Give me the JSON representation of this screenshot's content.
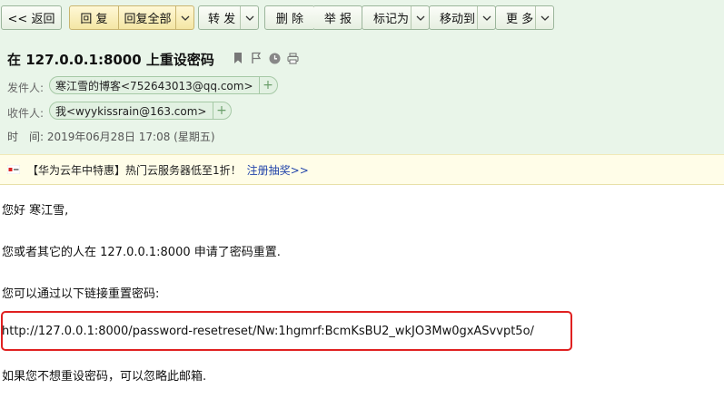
{
  "toolbar": {
    "back": "<< 返回",
    "reply": "回 复",
    "reply_all": "回复全部",
    "forward": "转 发",
    "delete": "删 除",
    "report": "举 报",
    "mark_as": "标记为",
    "move_to": "移动到",
    "more": "更 多"
  },
  "mail": {
    "subject": "在 127.0.0.1:8000 上重设密码",
    "from_label": "发件人:",
    "from_value": "寒江雪的博客<752643013@qq.com>",
    "to_label": "收件人:",
    "to_value": "我<wyykissrain@163.com>",
    "time_label": "时　间:",
    "time_value": "2019年06月28日 17:08 (星期五)"
  },
  "banner": {
    "text": "【华为云年中特惠】热门云服务器低至1折！",
    "link": "注册抽奖>>"
  },
  "body": {
    "greeting": "您好 寒江雪,",
    "line1": "您或者其它的人在 127.0.0.1:8000 申请了密码重置.",
    "line2": "您可以通过以下链接重置密码:",
    "reset_url": "http://127.0.0.1:8000/password-resetreset/Nw:1hgmrf:BcmKsBU2_wkJO3Mw0gxASvvpt5o/",
    "line3": "如果您不想重设密码，可以忽略此邮箱."
  },
  "colors": {
    "header_bg": "#e9f5e9",
    "highlight_border": "#e02020",
    "banner_bg": "#fffde8"
  }
}
